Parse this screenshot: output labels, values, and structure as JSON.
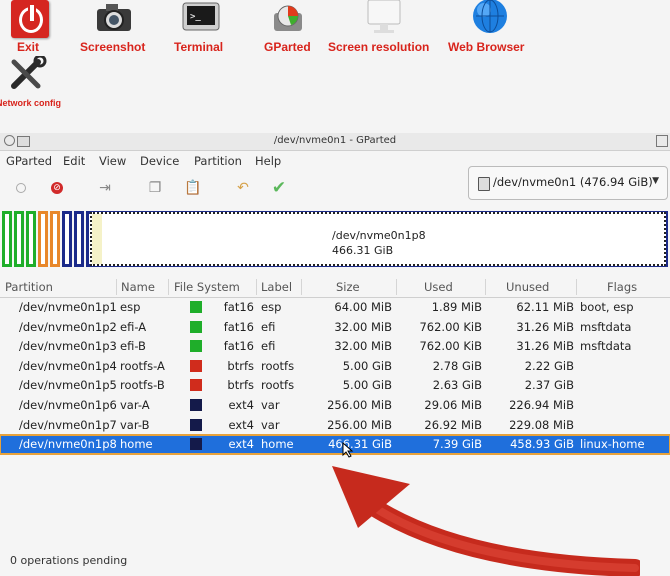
{
  "desktop": {
    "launchers": [
      {
        "label": "Exit",
        "icon": "power-icon"
      },
      {
        "label": "Screenshot",
        "icon": "camera-icon"
      },
      {
        "label": "Terminal",
        "icon": "terminal-icon"
      },
      {
        "label": "GParted",
        "icon": "gparted-icon"
      },
      {
        "label": "Screen resolution",
        "icon": "monitor-icon"
      },
      {
        "label": "Web Browser",
        "icon": "globe-icon"
      },
      {
        "label": "Network config",
        "icon": "tools-icon"
      }
    ]
  },
  "window": {
    "title": "/dev/nvme0n1 - GParted",
    "menu": [
      "GParted",
      "Edit",
      "View",
      "Device",
      "Partition",
      "Help"
    ],
    "device_selector": "/dev/nvme0n1  (476.94 GiB)",
    "graphic": {
      "selected_name": "/dev/nvme0n1p8",
      "selected_size": "466.31 GiB"
    },
    "columns": [
      "Partition",
      "Name",
      "File System",
      "Label",
      "Size",
      "Used",
      "Unused",
      "Flags"
    ],
    "rows": [
      {
        "partition": "/dev/nvme0n1p1",
        "name": "esp",
        "fs": "fat16",
        "label": "esp",
        "size": "64.00 MiB",
        "used": "1.89 MiB",
        "unused": "62.11 MiB",
        "flags": "boot, esp",
        "color": "#1fae2a"
      },
      {
        "partition": "/dev/nvme0n1p2",
        "name": "efi-A",
        "fs": "fat16",
        "label": "efi",
        "size": "32.00 MiB",
        "used": "762.00 KiB",
        "unused": "31.26 MiB",
        "flags": "msftdata",
        "color": "#1fae2a"
      },
      {
        "partition": "/dev/nvme0n1p3",
        "name": "efi-B",
        "fs": "fat16",
        "label": "efi",
        "size": "32.00 MiB",
        "used": "762.00 KiB",
        "unused": "31.26 MiB",
        "flags": "msftdata",
        "color": "#1fae2a"
      },
      {
        "partition": "/dev/nvme0n1p4",
        "name": "rootfs-A",
        "fs": "btrfs",
        "label": "rootfs",
        "size": "5.00 GiB",
        "used": "2.78 GiB",
        "unused": "2.22 GiB",
        "flags": "",
        "color": "#d02c1c"
      },
      {
        "partition": "/dev/nvme0n1p5",
        "name": "rootfs-B",
        "fs": "btrfs",
        "label": "rootfs",
        "size": "5.00 GiB",
        "used": "2.63 GiB",
        "unused": "2.37 GiB",
        "flags": "",
        "color": "#d02c1c"
      },
      {
        "partition": "/dev/nvme0n1p6",
        "name": "var-A",
        "fs": "ext4",
        "label": "var",
        "size": "256.00 MiB",
        "used": "29.06 MiB",
        "unused": "226.94 MiB",
        "flags": "",
        "color": "#141a4a"
      },
      {
        "partition": "/dev/nvme0n1p7",
        "name": "var-B",
        "fs": "ext4",
        "label": "var",
        "size": "256.00 MiB",
        "used": "26.92 MiB",
        "unused": "229.08 MiB",
        "flags": "",
        "color": "#141a4a"
      },
      {
        "partition": "/dev/nvme0n1p8",
        "name": "home",
        "fs": "ext4",
        "label": "home",
        "size": "466.31 GiB",
        "used": "7.39 GiB",
        "unused": "458.93 GiB",
        "flags": "linux-home",
        "color": "#141a4a"
      }
    ],
    "status": "0 operations pending"
  }
}
